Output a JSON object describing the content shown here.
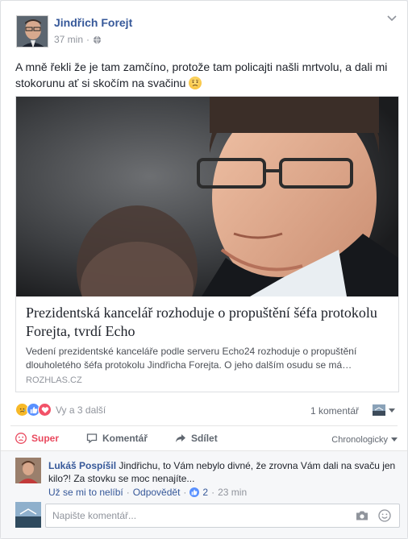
{
  "post": {
    "author": "Jindřich Forejt",
    "time": "37 min",
    "privacy_icon": "globe-icon",
    "text": "A mně řekli že je tam zamčíno, protože tam policajti našli mrtvolu, a dali mi stokorunu ať si skočím na svačinu",
    "text_emoji": "worried-face-emoji"
  },
  "link_preview": {
    "title": "Prezidentská kancelář rozhoduje o propuštění šéfa protokolu Forejta, tvrdí Echo",
    "description": "Vedení prezidentské kanceláře podle serveru Echo24 rozhoduje o propuštění dlouholetého šéfa protokolu Jindřicha Forejta. O jeho dalším osudu se má…",
    "source": "ROZHLAS.CZ"
  },
  "reactions": {
    "summary": "Vy a 3 další",
    "comments_count": "1 komentář",
    "icons": [
      "sad-reaction-icon",
      "like-reaction-icon",
      "love-reaction-icon"
    ]
  },
  "actions": {
    "like": "Super",
    "comment": "Komentář",
    "share": "Sdílet",
    "sort": "Chronologicky"
  },
  "comment": {
    "name": "Lukáš Pospíšil",
    "text": "Jindřichu, to Vám nebylo divné, že zrovna Vám dali na svaču jen kilo?! Za stovku se moc nenajíte...",
    "unlike": "Už se mi to nelíbí",
    "reply": "Odpovědět",
    "likes": "2",
    "time": "23 min"
  },
  "composer": {
    "placeholder": "Napište komentář..."
  },
  "colors": {
    "link": "#365899",
    "like_active": "#e9495e",
    "meta_gray": "#90949c",
    "background": "#e9ebee"
  }
}
